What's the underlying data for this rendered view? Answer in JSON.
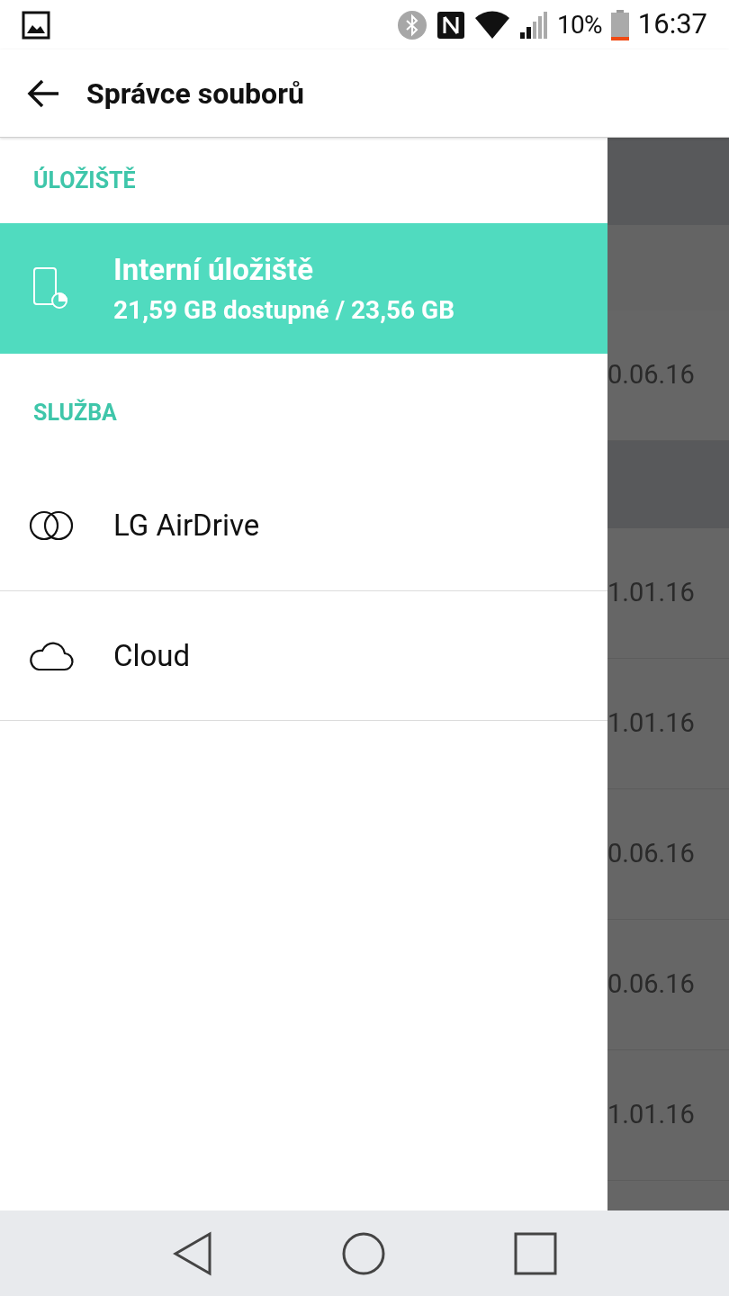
{
  "status_bar": {
    "battery_text": "10%",
    "time": "16:37"
  },
  "app_bar": {
    "title": "Správce souborů"
  },
  "drawer": {
    "sections": [
      {
        "header": "ÚLOŽIŠTĚ",
        "items": [
          {
            "label": "Interní úložiště",
            "subtitle": "21,59 GB dostupné / 23,56 GB",
            "selected": true
          }
        ]
      },
      {
        "header": "SLUŽBA",
        "items": [
          {
            "label": "LG AirDrive",
            "selected": false
          },
          {
            "label": "Cloud",
            "selected": false
          }
        ]
      }
    ]
  },
  "background_list": [
    {
      "kind": "header"
    },
    {
      "kind": "subheader"
    },
    {
      "kind": "file",
      "date": "0.06.16"
    },
    {
      "kind": "header"
    },
    {
      "kind": "file",
      "date": "1.01.16"
    },
    {
      "kind": "file",
      "date": "1.01.16"
    },
    {
      "kind": "file",
      "date": "0.06.16"
    },
    {
      "kind": "file",
      "date": "0.06.16"
    },
    {
      "kind": "file",
      "date": "1.01.16"
    },
    {
      "kind": "file"
    }
  ]
}
